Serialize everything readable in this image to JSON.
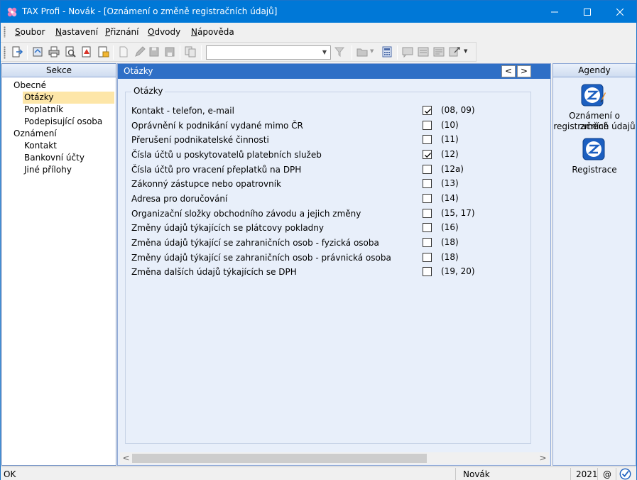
{
  "window": {
    "title": "TAX Profi - Novák - [Oznámení o změně registračních údajů]"
  },
  "menu": [
    {
      "label": "Soubor",
      "accel": "S",
      "rest": "oubor"
    },
    {
      "label": "Nastavení",
      "accel": "N",
      "rest": "astavení"
    },
    {
      "label": "Přiznání",
      "accel": "P",
      "rest": "řiznání"
    },
    {
      "label": "Odvody",
      "accel": "O",
      "rest": "dvody"
    },
    {
      "label": "Nápověda",
      "accel": "N",
      "rest": "ápověda"
    }
  ],
  "toolbar": {
    "combo_value": ""
  },
  "left_panel": {
    "header": "Sekce",
    "items": [
      {
        "label": "Obecné",
        "level": 0,
        "selected": false
      },
      {
        "label": "Otázky",
        "level": 1,
        "selected": true
      },
      {
        "label": "Poplatník",
        "level": 1,
        "selected": false
      },
      {
        "label": "Podepisující osoba",
        "level": 1,
        "selected": false
      },
      {
        "label": "Oznámení",
        "level": 0,
        "selected": false
      },
      {
        "label": "Kontakt",
        "level": 1,
        "selected": false
      },
      {
        "label": "Bankovní účty",
        "level": 1,
        "selected": false
      },
      {
        "label": "Jiné přílohy",
        "level": 1,
        "selected": false
      }
    ]
  },
  "center": {
    "header": "Otázky",
    "nav_prev": "<",
    "nav_next": ">",
    "group_title": "Otázky",
    "questions": [
      {
        "label": "Kontakt - telefon, e-mail",
        "checked": true,
        "code": "(08, 09)"
      },
      {
        "label": "Oprávnění k podnikání vydané mimo ČR",
        "checked": false,
        "code": "(10)"
      },
      {
        "label": "Přerušení podnikatelské činnosti",
        "checked": false,
        "code": "(11)"
      },
      {
        "label": "Čísla účtů u poskytovatelů platebních služeb",
        "checked": true,
        "code": "(12)"
      },
      {
        "label": "Čísla účtů pro vracení přeplatků na DPH",
        "checked": false,
        "code": "(12a)"
      },
      {
        "label": "Zákonný zástupce nebo opatrovník",
        "checked": false,
        "code": "(13)"
      },
      {
        "label": "Adresa pro doručování",
        "checked": false,
        "code": "(14)"
      },
      {
        "label": "Organizační složky obchodního závodu a jejich změny",
        "checked": false,
        "code": "(15, 17)"
      },
      {
        "label": "Změny údajů týkajících se plátcovy pokladny",
        "checked": false,
        "code": "(16)"
      },
      {
        "label": "Změna údajů týkající se zahraničních osob - fyzická osoba",
        "checked": false,
        "code": "(18)"
      },
      {
        "label": "Změny údajů týkající se zahraničních osob - právnická osoba",
        "checked": false,
        "code": "(18)"
      },
      {
        "label": "Změna dalších údajů týkajících se DPH",
        "checked": false,
        "code": "(19, 20)"
      }
    ],
    "scroll_left": "<",
    "scroll_right": ">"
  },
  "right_panel": {
    "header": "Agendy",
    "items": [
      {
        "label_line1": "Oznámení o změně",
        "label_line2": "registračních údajů",
        "icon": "registration-change-icon"
      },
      {
        "label_line1": "Registrace",
        "label_line2": "",
        "icon": "registration-icon"
      }
    ]
  },
  "status": {
    "left": "OK",
    "user": "Novák",
    "year": "2021",
    "at": "@"
  },
  "colors": {
    "titlebar": "#0078d7",
    "center_header": "#2f6fc6",
    "selection": "#fde6a8",
    "panel_bg": "#e8effa"
  }
}
